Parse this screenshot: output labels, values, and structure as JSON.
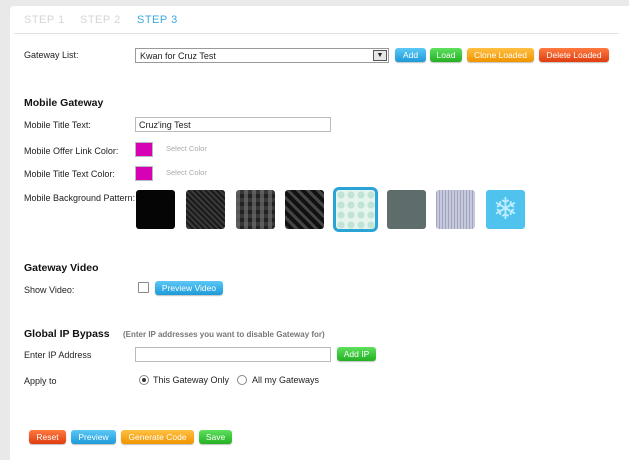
{
  "steps": [
    {
      "label": "STEP 1",
      "active": false
    },
    {
      "label": "STEP 2",
      "active": false
    },
    {
      "label": "STEP 3",
      "active": true
    }
  ],
  "gateway_list": {
    "label": "Gateway List:",
    "selected": "Kwan for Cruz Test",
    "buttons": {
      "add": "Add",
      "load": "Load",
      "clone": "Clone Loaded",
      "delete": "Delete Loaded"
    }
  },
  "mobile_gateway": {
    "heading": "Mobile Gateway",
    "title_text_label": "Mobile Title Text:",
    "title_text_value": "Cruz'ing Test",
    "offer_link_color_label": "Mobile Offer Link Color:",
    "offer_link_color": "#d600b4",
    "title_text_color_label": "Mobile Title Text Color:",
    "title_text_color": "#d600b4",
    "select_color_label": "Select Color",
    "background_pattern_label": "Mobile Background Pattern:",
    "patterns": [
      {
        "name": "black-solid",
        "selected": false
      },
      {
        "name": "dark-carbon",
        "selected": false
      },
      {
        "name": "dark-weave",
        "selected": false
      },
      {
        "name": "dark-diamond",
        "selected": false
      },
      {
        "name": "light-teal-dots",
        "selected": true
      },
      {
        "name": "slate-gray",
        "selected": false
      },
      {
        "name": "lavender-lines",
        "selected": false
      },
      {
        "name": "blue-snowflakes",
        "selected": false
      }
    ]
  },
  "gateway_video": {
    "heading": "Gateway Video",
    "show_label": "Show Video:",
    "show_checked": false,
    "preview_button": "Preview Video"
  },
  "ip_bypass": {
    "heading": "Global IP Bypass",
    "hint": "(Enter IP addresses you want to disable Gateway for)",
    "ip_label": "Enter IP Address",
    "ip_value": "",
    "add_button": "Add IP",
    "apply_label": "Apply to",
    "options": [
      {
        "label": "This Gateway Only",
        "selected": true
      },
      {
        "label": "All my Gateways",
        "selected": false
      }
    ]
  },
  "footer_buttons": {
    "reset": "Reset",
    "preview": "Preview",
    "generate": "Generate Code",
    "save": "Save"
  },
  "colors": {
    "accent_blue": "#3aa8e0",
    "green": "#23b023",
    "orange": "#ef9400",
    "red": "#df3d10",
    "magenta": "#d600b4"
  }
}
